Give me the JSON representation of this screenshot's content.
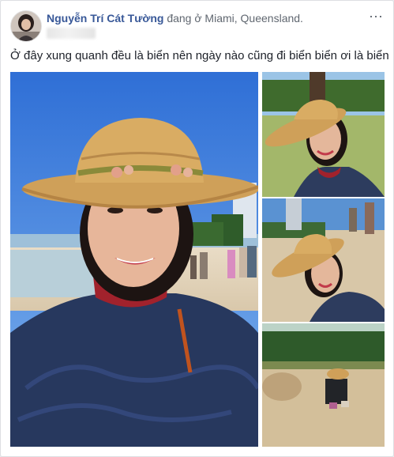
{
  "post": {
    "author": "Nguyễn Trí Cát Tường",
    "checkin_text": "đang ở Miami, Queensland.",
    "caption": "Ở đây xung quanh đều là biển nên ngày nào cũng đi biển biển ơi là biển ...",
    "more_icon": "more-options-icon"
  },
  "photos": [
    {
      "id": "selfie-beach-main",
      "icon": "photo"
    },
    {
      "id": "selfie-park",
      "icon": "photo"
    },
    {
      "id": "selfie-sand",
      "icon": "photo"
    },
    {
      "id": "digging-sand",
      "icon": "photo"
    }
  ],
  "colors": {
    "author_link": "#385898",
    "text": "#1d2129",
    "meta": "#606770"
  }
}
